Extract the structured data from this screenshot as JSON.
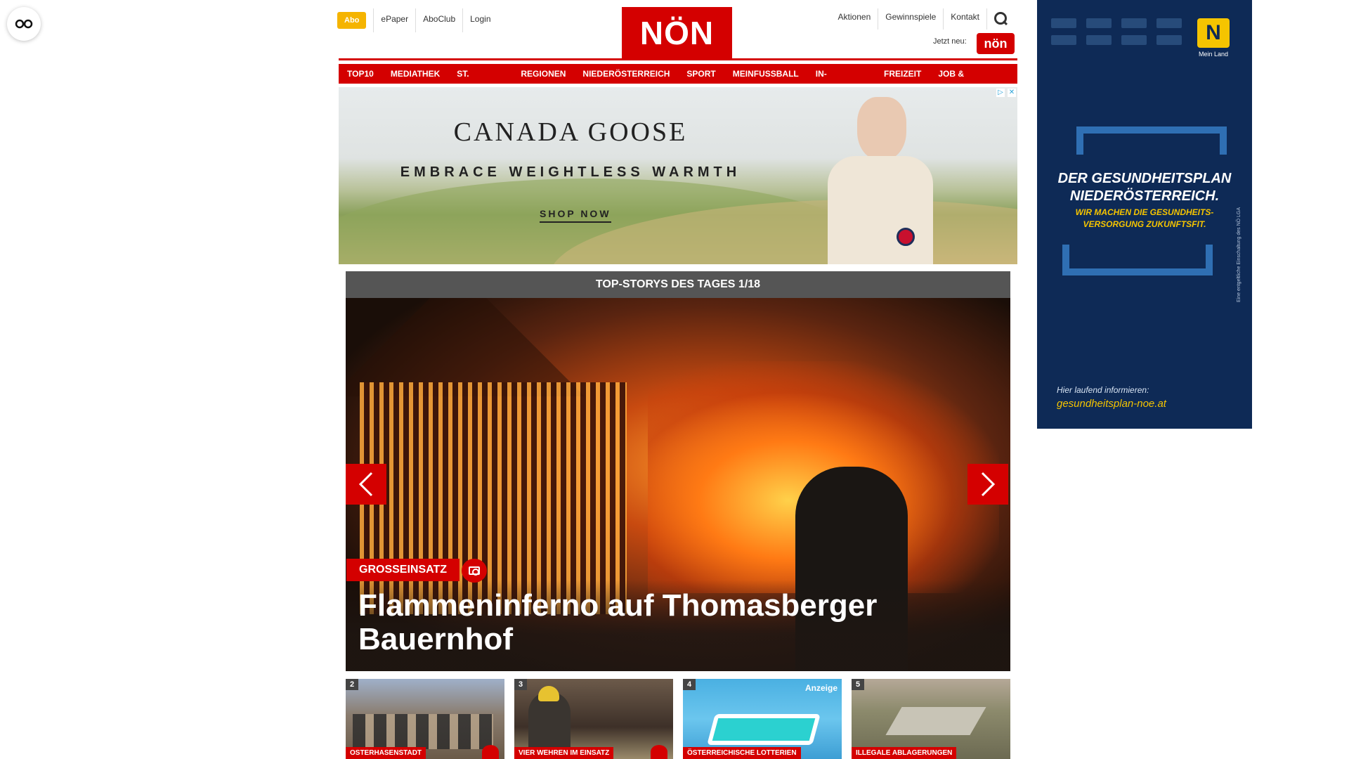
{
  "header": {
    "abo": "Abo",
    "top_links": [
      "ePaper",
      "AboClub",
      "Login"
    ],
    "logo": "NÖN",
    "right_links": [
      "Aktionen",
      "Gewinnspiele",
      "Kontakt"
    ],
    "jetzt_neu": "Jetzt neu:",
    "jetzt_badge": "nön"
  },
  "nav": [
    "TOP10",
    "MEDIATHEK",
    "ST. PÖLTEN",
    "REGIONEN",
    "NIEDERÖSTERREICH",
    "SPORT",
    "MEINFUSSBALL",
    "IN-AUSLAND",
    "FREIZEIT",
    "JOB & KARRIERE"
  ],
  "ad": {
    "brand": "CANADA GOOSE",
    "tagline": "EMBRACE WEIGHTLESS WARMTH",
    "cta": "SHOP NOW",
    "adchoices_icon": "adchoices-icon",
    "close_icon": "close-icon"
  },
  "top_stories": {
    "header": "TOP-STORYS DES TAGES 1/18",
    "category": "GROSSEINSATZ",
    "title": "Flammeninferno auf Thomasberger Bauernhof",
    "prev_icon": "chevron-left-icon",
    "next_icon": "chevron-right-icon"
  },
  "thumbs": [
    {
      "num": "2",
      "category": "OSTERHASENSTADT",
      "camera": true
    },
    {
      "num": "3",
      "category": "VIER WEHREN IM EINSATZ",
      "camera": true
    },
    {
      "num": "4",
      "category": "ÖSTERREICHISCHE LOTTERIEN",
      "badge": "Anzeige"
    },
    {
      "num": "5",
      "category": "ILLEGALE ABLAGERUNGEN"
    }
  ],
  "side_ad": {
    "headline_1": "DER GESUNDHEITSPLAN",
    "headline_2": "NIEDERÖSTERREICH.",
    "sub_1": "WIR MACHEN DIE GESUNDHEITS-",
    "sub_2": "VERSORGUNG ZUKUNFTSFIT.",
    "info": "Hier laufend informieren:",
    "url": "gesundheitsplan-noe.at",
    "logo_letter": "N",
    "logo_caption": "Mein Land",
    "vertical": "Eine entgeltliche Einschaltung des NÖ LGA"
  },
  "colors": {
    "brand_red": "#d40000",
    "abo_yellow": "#f5b400",
    "side_navy": "#0e2a56"
  }
}
